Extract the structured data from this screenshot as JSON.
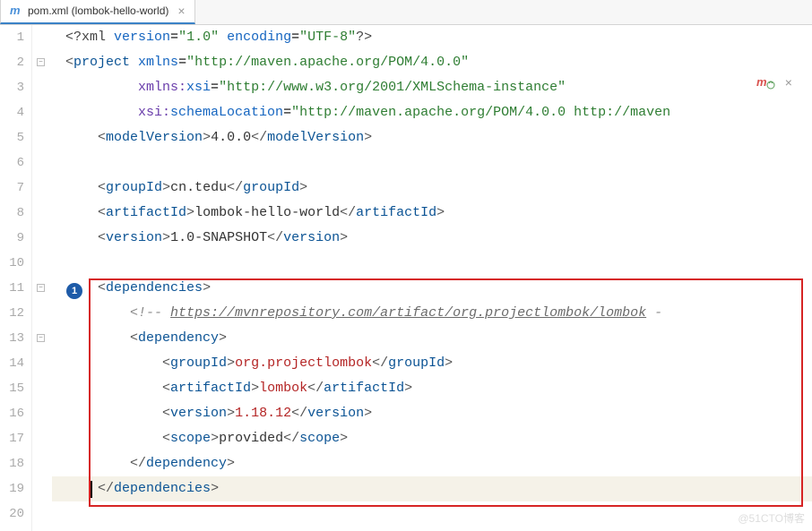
{
  "tab": {
    "icon_letter": "m",
    "label": "pom.xml (lombok-hello-world)"
  },
  "annotation_number": "1",
  "watermark": "@51CTO博客",
  "lines": [
    {
      "n": "1",
      "html": "<span class='tk-decl'>&lt;?xml</span> <span class='tk-attr'>version</span>=<span class='tk-str'>\"1.0\"</span> <span class='tk-attr'>encoding</span>=<span class='tk-str'>\"UTF-8\"</span><span class='tk-decl'>?&gt;</span>"
    },
    {
      "n": "2",
      "fold": "-",
      "html": "<span class='tk-pun'>&lt;</span><span class='tk-tag'>project</span> <span class='tk-attr'>xmlns</span>=<span class='tk-str'>\"http://maven.apache.org/POM/4.0.0\"</span>"
    },
    {
      "n": "3",
      "html": "         <span class='tk-ns'>xmlns:</span><span class='tk-attr'>xsi</span>=<span class='tk-str'>\"http://www.w3.org/2001/XMLSchema-instance\"</span>"
    },
    {
      "n": "4",
      "html": "         <span class='tk-ns'>xsi:</span><span class='tk-attr'>schemaLocation</span>=<span class='tk-str'>\"http://maven.apache.org/POM/4.0.0 http://maven</span>"
    },
    {
      "n": "5",
      "html": "    <span class='tk-pun'>&lt;</span><span class='tk-tag'>modelVersion</span><span class='tk-pun'>&gt;</span><span class='tk-txt'>4.0.0</span><span class='tk-pun'>&lt;/</span><span class='tk-tag'>modelVersion</span><span class='tk-pun'>&gt;</span>"
    },
    {
      "n": "6",
      "html": ""
    },
    {
      "n": "7",
      "html": "    <span class='tk-pun'>&lt;</span><span class='tk-tag'>groupId</span><span class='tk-pun'>&gt;</span><span class='tk-txt'>cn.tedu</span><span class='tk-pun'>&lt;/</span><span class='tk-tag'>groupId</span><span class='tk-pun'>&gt;</span>"
    },
    {
      "n": "8",
      "html": "    <span class='tk-pun'>&lt;</span><span class='tk-tag'>artifactId</span><span class='tk-pun'>&gt;</span><span class='tk-txt'>lombok-hello-world</span><span class='tk-pun'>&lt;/</span><span class='tk-tag'>artifactId</span><span class='tk-pun'>&gt;</span>"
    },
    {
      "n": "9",
      "html": "    <span class='tk-pun'>&lt;</span><span class='tk-tag'>version</span><span class='tk-pun'>&gt;</span><span class='tk-txt'>1.0-SNAPSHOT</span><span class='tk-pun'>&lt;/</span><span class='tk-tag'>version</span><span class='tk-pun'>&gt;</span>"
    },
    {
      "n": "10",
      "html": ""
    },
    {
      "n": "11",
      "fold": "-",
      "html": "    <span class='tk-pun'>&lt;</span><span class='tk-tag'>dependencies</span><span class='tk-pun'>&gt;</span>"
    },
    {
      "n": "12",
      "html": "        <span class='tk-cmt'>&lt;!--</span> <span class='tk-url'>https://mvnrepository.com/artifact/org.projectlombok/lombok</span> <span class='tk-cmt'>-</span>"
    },
    {
      "n": "13",
      "fold": "-",
      "html": "        <span class='tk-pun'>&lt;</span><span class='tk-tag'>dependency</span><span class='tk-pun'>&gt;</span>"
    },
    {
      "n": "14",
      "html": "            <span class='tk-pun'>&lt;</span><span class='tk-tag'>groupId</span><span class='tk-pun'>&gt;</span><span class='tk-val'>org.projectlombok</span><span class='tk-pun'>&lt;/</span><span class='tk-tag'>groupId</span><span class='tk-pun'>&gt;</span>"
    },
    {
      "n": "15",
      "html": "            <span class='tk-pun'>&lt;</span><span class='tk-tag'>artifactId</span><span class='tk-pun'>&gt;</span><span class='tk-val'>lombok</span><span class='tk-pun'>&lt;/</span><span class='tk-tag'>artifactId</span><span class='tk-pun'>&gt;</span>"
    },
    {
      "n": "16",
      "html": "            <span class='tk-pun'>&lt;</span><span class='tk-tag'>version</span><span class='tk-pun'>&gt;</span><span class='tk-val'>1.18.12</span><span class='tk-pun'>&lt;/</span><span class='tk-tag'>version</span><span class='tk-pun'>&gt;</span>"
    },
    {
      "n": "17",
      "html": "            <span class='tk-pun'>&lt;</span><span class='tk-tag'>scope</span><span class='tk-pun'>&gt;</span><span class='tk-txt'>provided</span><span class='tk-pun'>&lt;/</span><span class='tk-tag'>scope</span><span class='tk-pun'>&gt;</span>"
    },
    {
      "n": "18",
      "fold": "e",
      "html": "        <span class='tk-pun'>&lt;/</span><span class='tk-tag'>dependency</span><span class='tk-pun'>&gt;</span>"
    },
    {
      "n": "19",
      "fold": "e",
      "cur": true,
      "html": "    <span class='tk-pun'>&lt;/</span><span class='tk-tag'>dependencies</span><span class='tk-pun'>&gt;</span>"
    },
    {
      "n": "20",
      "html": ""
    }
  ]
}
